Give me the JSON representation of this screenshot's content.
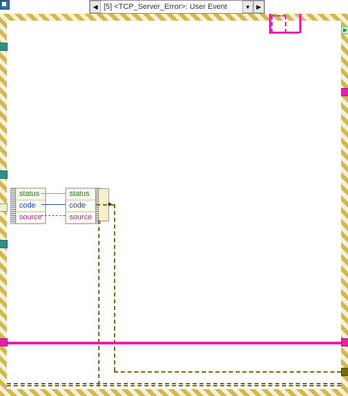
{
  "case": {
    "index_label": "[5]",
    "event_name": "<TCP_Server_Error>: User Event"
  },
  "unbundle": {
    "fields": [
      "status",
      "code",
      "source"
    ]
  },
  "bundle": {
    "fields": [
      "status",
      "code",
      "source"
    ]
  }
}
